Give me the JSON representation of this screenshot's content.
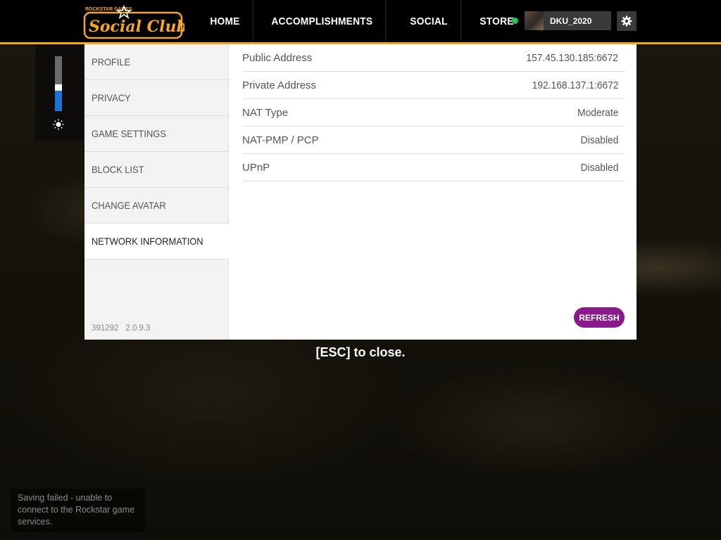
{
  "brand": {
    "logo_small": "ROCKSTAR GAMES",
    "logo_main": "Social Club",
    "accent_color": "#f5a623"
  },
  "nav": {
    "items": [
      {
        "label": "HOME"
      },
      {
        "label": "ACCOMPLISHMENTS"
      },
      {
        "label": "SOCIAL"
      },
      {
        "label": "STORE"
      }
    ]
  },
  "user": {
    "name": "DKU_2020",
    "online_color": "#23c552"
  },
  "brightness": {
    "level_fraction": 0.4
  },
  "sidebar": {
    "items": [
      {
        "label": "PROFILE"
      },
      {
        "label": "PRIVACY"
      },
      {
        "label": "GAME SETTINGS"
      },
      {
        "label": "BLOCK LIST"
      },
      {
        "label": "CHANGE AVATAR"
      },
      {
        "label": "NETWORK INFORMATION",
        "active": true
      }
    ],
    "version_id": "391292",
    "version": "2.0.9.3"
  },
  "network": {
    "rows": [
      {
        "label": "Public Address",
        "value": "157.45.130.185:6672"
      },
      {
        "label": "Private Address",
        "value": "192.168.137.1:6672"
      },
      {
        "label": "NAT Type",
        "value": "Moderate"
      },
      {
        "label": "NAT-PMP / PCP",
        "value": "Disabled"
      },
      {
        "label": "UPnP",
        "value": "Disabled"
      }
    ],
    "refresh_label": "REFRESH",
    "refresh_color": "#8a1a8c"
  },
  "hint": "[ESC] to close.",
  "toast": "Saving failed - unable to connect to the Rockstar game services."
}
